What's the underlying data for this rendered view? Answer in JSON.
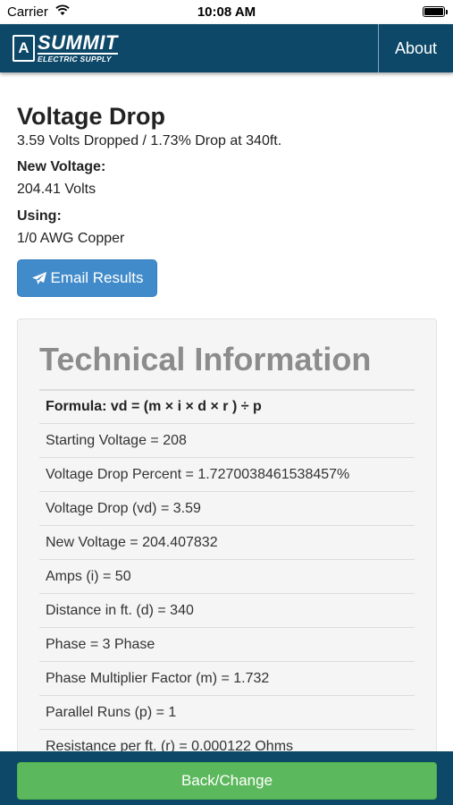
{
  "status_bar": {
    "carrier": "Carrier",
    "time": "10:08 AM",
    "wifi_icon": "wifi-icon",
    "battery_icon": "battery-icon"
  },
  "navbar": {
    "logo_mark": "A",
    "logo_title": "SUMMIT",
    "logo_subtitle": "ELECTRIC SUPPLY",
    "about_label": "About",
    "background_color": "#0d4868"
  },
  "result": {
    "title": "Voltage Drop",
    "summary": "3.59 Volts Dropped / 1.73% Drop at 340ft.",
    "new_voltage_label": "New Voltage:",
    "new_voltage_value": "204.41 Volts",
    "using_label": "Using:",
    "using_value": "1/0 AWG Copper"
  },
  "email_button": {
    "label": "Email Results",
    "icon": "send-icon",
    "color": "#428bca"
  },
  "technical": {
    "title": "Technical Information",
    "formula": "Formula: vd = (m × i × d × r ) ÷ p",
    "rows": [
      "Starting Voltage = 208",
      "Voltage Drop Percent = 1.7270038461538457%",
      "Voltage Drop (vd) = 3.59",
      "New Voltage = 204.407832",
      "Amps (i) = 50",
      "Distance in ft. (d) = 340",
      "Phase = 3 Phase",
      "Phase Multiplier Factor (m) = 1.732",
      "Parallel Runs (p) = 1",
      "Resistance per ft. (r) = 0.000122 Ohms"
    ]
  },
  "footer": {
    "back_label": "Back/Change",
    "button_color": "#5cb85c"
  }
}
